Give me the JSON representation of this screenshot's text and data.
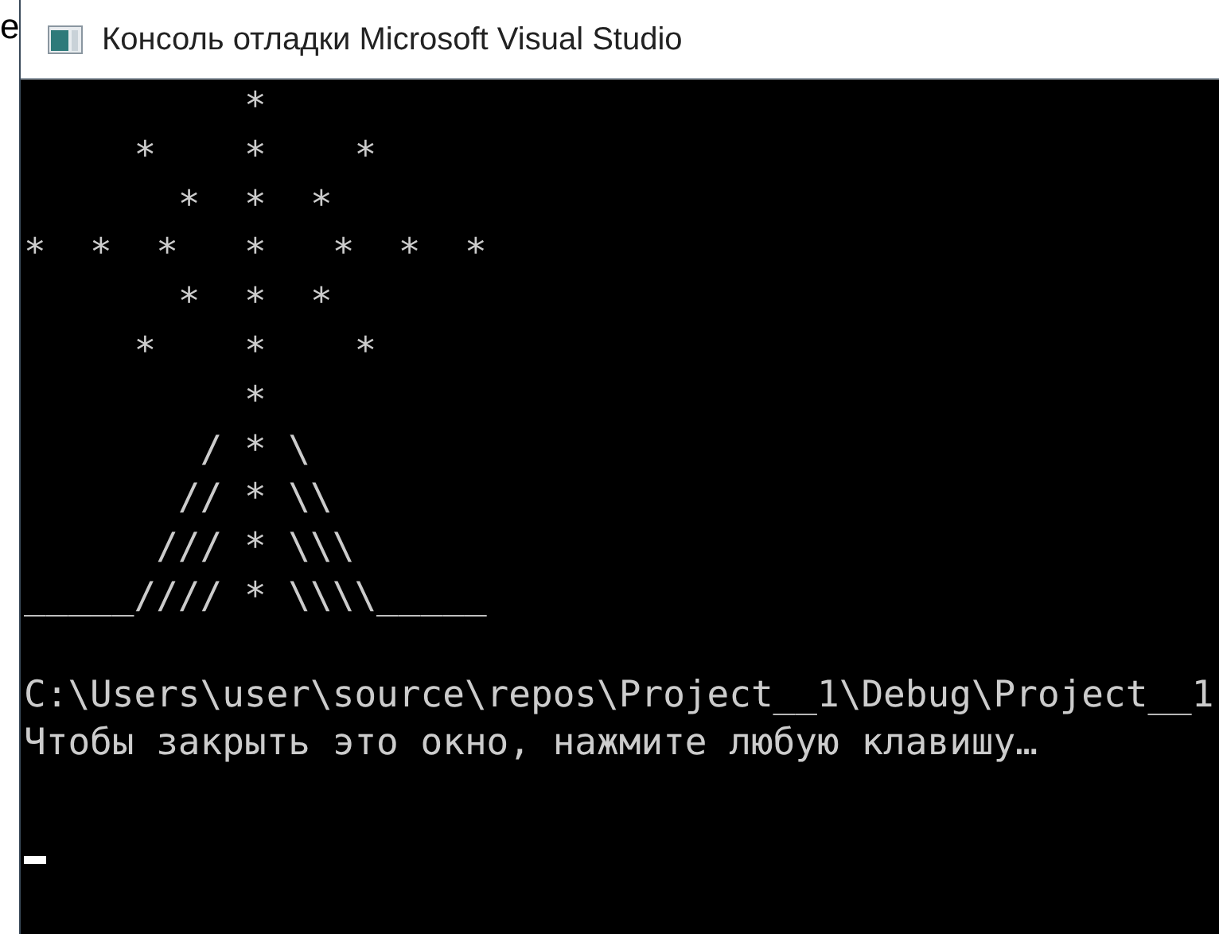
{
  "background_text": "e",
  "window": {
    "title": "Консоль отладки Microsoft Visual Studio"
  },
  "console": {
    "art": "          *\n     *    *    *\n       *  *  *\n*  *  *   *   *  *  *\n       *  *  *\n     *    *    *\n          *\n        / * \\\n       // * \\\\\n      /// * \\\\\\\n_____//// * \\\\\\\\_____",
    "messages": [
      "C:\\Users\\user\\source\\repos\\Project__1\\Debug\\Project__1",
      "Чтобы закрыть это окно, нажмите любую клавишу…"
    ],
    "cursor_visible": true
  }
}
